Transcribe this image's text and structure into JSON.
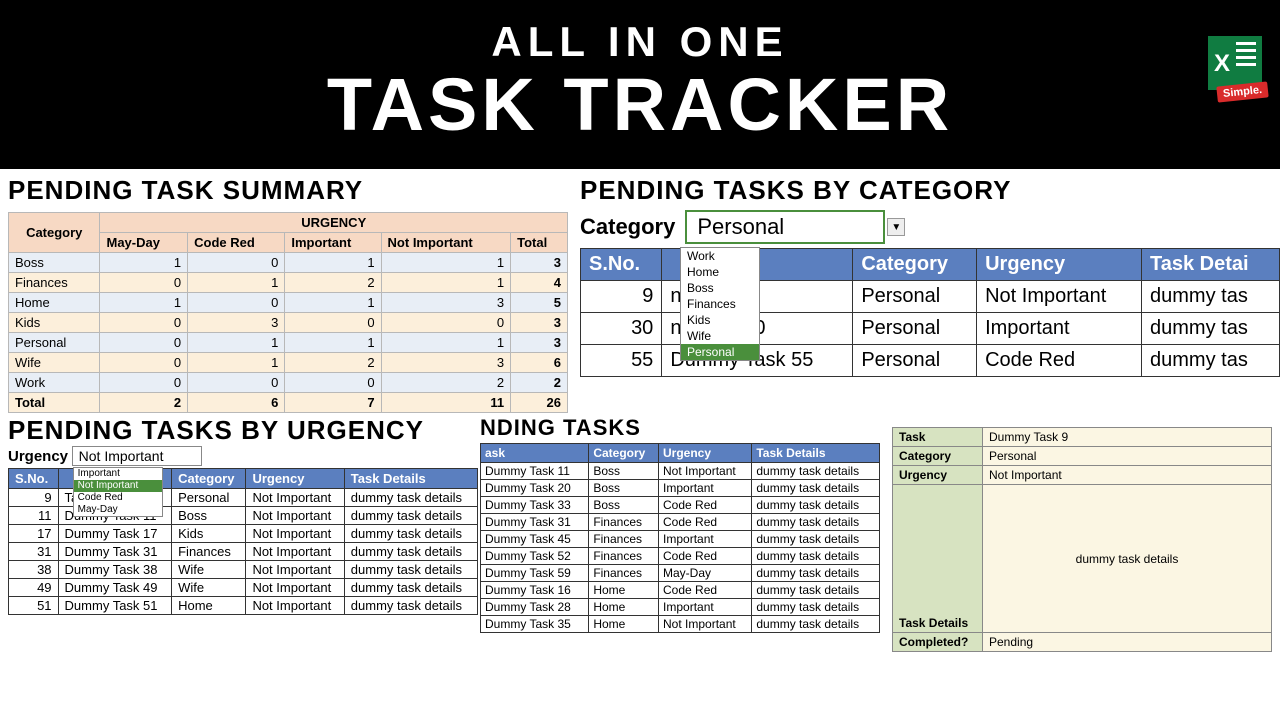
{
  "header": {
    "line1": "ALL IN ONE",
    "line2": "TASK TRACKER",
    "logo_badge": "Simple."
  },
  "summary": {
    "title": "PENDING TASK SUMMARY",
    "head_cat": "Category",
    "head_urg": "URGENCY",
    "cols": [
      "May-Day",
      "Code Red",
      "Important",
      "Not Important",
      "Total"
    ],
    "rows": [
      {
        "cat": "Boss",
        "v": [
          1,
          0,
          1,
          1,
          3
        ]
      },
      {
        "cat": "Finances",
        "v": [
          0,
          1,
          2,
          1,
          4
        ]
      },
      {
        "cat": "Home",
        "v": [
          1,
          0,
          1,
          3,
          5
        ]
      },
      {
        "cat": "Kids",
        "v": [
          0,
          3,
          0,
          0,
          3
        ]
      },
      {
        "cat": "Personal",
        "v": [
          0,
          1,
          1,
          1,
          3
        ]
      },
      {
        "cat": "Wife",
        "v": [
          0,
          1,
          2,
          3,
          6
        ]
      },
      {
        "cat": "Work",
        "v": [
          0,
          0,
          0,
          2,
          2
        ]
      }
    ],
    "total_label": "Total",
    "totals": [
      2,
      6,
      7,
      11,
      26
    ]
  },
  "bycat": {
    "title": "PENDING TASKS BY CATEGORY",
    "label": "Category",
    "selected": "Personal",
    "options": [
      "Work",
      "Home",
      "Boss",
      "Finances",
      "Kids",
      "Wife",
      "Personal"
    ],
    "cols": [
      "S.No.",
      "",
      "Category",
      "Urgency",
      "Task Detai"
    ],
    "rows": [
      {
        "sno": 9,
        "task": "ny Task 9",
        "cat": "Personal",
        "urg": "Not Important",
        "det": "dummy tas"
      },
      {
        "sno": 30,
        "task": "ny Task 30",
        "cat": "Personal",
        "urg": "Important",
        "det": "dummy tas"
      },
      {
        "sno": 55,
        "task": "Dummy Task 55",
        "cat": "Personal",
        "urg": "Code Red",
        "det": "dummy tas"
      }
    ]
  },
  "byurg": {
    "title": "PENDING TASKS BY URGENCY",
    "label": "Urgency",
    "selected": "Not Important",
    "options": [
      "Important",
      "Not Important",
      "Code Red",
      "May-Day"
    ],
    "cols": [
      "S.No.",
      "",
      "Category",
      "Urgency",
      "Task Details"
    ],
    "rows": [
      {
        "sno": 9,
        "task": "Task 9",
        "cat": "Personal",
        "urg": "Not Important",
        "det": "dummy task details"
      },
      {
        "sno": 11,
        "task": "Dummy Task 11",
        "cat": "Boss",
        "urg": "Not Important",
        "det": "dummy task details"
      },
      {
        "sno": 17,
        "task": "Dummy Task 17",
        "cat": "Kids",
        "urg": "Not Important",
        "det": "dummy task details"
      },
      {
        "sno": 31,
        "task": "Dummy Task 31",
        "cat": "Finances",
        "urg": "Not Important",
        "det": "dummy task details"
      },
      {
        "sno": 38,
        "task": "Dummy Task 38",
        "cat": "Wife",
        "urg": "Not Important",
        "det": "dummy task details"
      },
      {
        "sno": 49,
        "task": "Dummy Task 49",
        "cat": "Wife",
        "urg": "Not Important",
        "det": "dummy task details"
      },
      {
        "sno": 51,
        "task": "Dummy Task 51",
        "cat": "Home",
        "urg": "Not Important",
        "det": "dummy task details"
      }
    ]
  },
  "ptasks": {
    "title": "NDING TASKS",
    "cols": [
      "ask",
      "Category",
      "Urgency",
      "Task Details"
    ],
    "rows": [
      {
        "task": "Dummy Task 11",
        "cat": "Boss",
        "urg": "Not Important",
        "det": "dummy task details"
      },
      {
        "task": "Dummy Task 20",
        "cat": "Boss",
        "urg": "Important",
        "det": "dummy task details"
      },
      {
        "task": "Dummy Task 33",
        "cat": "Boss",
        "urg": "Code Red",
        "det": "dummy task details"
      },
      {
        "task": "Dummy Task 31",
        "cat": "Finances",
        "urg": "Code Red",
        "det": "dummy task details"
      },
      {
        "task": "Dummy Task 45",
        "cat": "Finances",
        "urg": "Important",
        "det": "dummy task details"
      },
      {
        "task": "Dummy Task 52",
        "cat": "Finances",
        "urg": "Code Red",
        "det": "dummy task details"
      },
      {
        "task": "Dummy Task 59",
        "cat": "Finances",
        "urg": "May-Day",
        "det": "dummy task details"
      },
      {
        "task": "Dummy Task 16",
        "cat": "Home",
        "urg": "Code Red",
        "det": "dummy task details"
      },
      {
        "task": "Dummy Task 28",
        "cat": "Home",
        "urg": "Important",
        "det": "dummy task details"
      },
      {
        "task": "Dummy Task 35",
        "cat": "Home",
        "urg": "Not Important",
        "det": "dummy task details"
      }
    ]
  },
  "detail": {
    "k_task": "Task",
    "v_task": "Dummy Task 9",
    "k_cat": "Category",
    "v_cat": "Personal",
    "k_urg": "Urgency",
    "v_urg": "Not Important",
    "k_det": "Task Details",
    "v_det": "dummy task details",
    "k_comp": "Completed?",
    "v_comp": "Pending"
  }
}
